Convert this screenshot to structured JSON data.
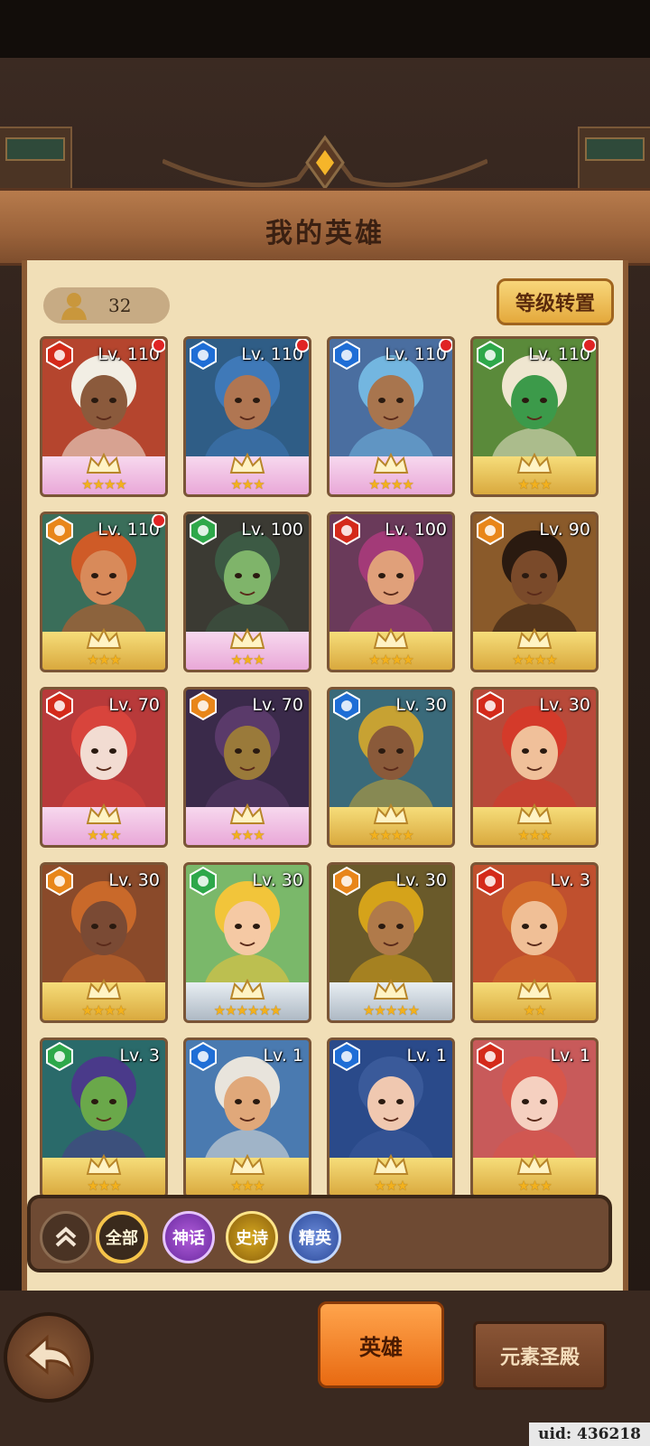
{
  "header": {
    "title": "我的英雄"
  },
  "hero_count": "32",
  "level_reset_label": "等级转置",
  "heroes": [
    {
      "level": "Lv. 110",
      "element": "fire",
      "stars": "★★★★",
      "frame": "pink",
      "badge": true,
      "skin": "#8b5a3c",
      "hair": "#f2eee4",
      "bg": "#b5452e"
    },
    {
      "level": "Lv. 110",
      "element": "water",
      "stars": "★★★",
      "frame": "pink",
      "badge": true,
      "skin": "#b07652",
      "hair": "#3f79b8",
      "bg": "#2f5d86"
    },
    {
      "level": "Lv. 110",
      "element": "water",
      "stars": "★★★★",
      "frame": "pink",
      "badge": true,
      "skin": "#a8754e",
      "hair": "#73b6e0",
      "bg": "#4a6ea0"
    },
    {
      "level": "Lv. 110",
      "element": "nature",
      "stars": "★★★",
      "frame": "gold",
      "badge": true,
      "skin": "#3c9a4a",
      "hair": "#efe6d0",
      "bg": "#5a8a3a"
    },
    {
      "level": "Lv. 110",
      "element": "earth",
      "stars": "★★★",
      "frame": "gold",
      "badge": true,
      "skin": "#d88a5a",
      "hair": "#cf5b27",
      "bg": "#3a6e5a"
    },
    {
      "level": "Lv. 100",
      "element": "nature",
      "stars": "★★★",
      "frame": "pink",
      "badge": false,
      "skin": "#7fb46a",
      "hair": "#3c5a44",
      "bg": "#3b3a33"
    },
    {
      "level": "Lv. 100",
      "element": "fire",
      "stars": "★★★★",
      "frame": "gold",
      "badge": false,
      "skin": "#e0a07a",
      "hair": "#a33a78",
      "bg": "#6a3a5a"
    },
    {
      "level": "Lv. 90",
      "element": "earth",
      "stars": "★★★★",
      "frame": "gold",
      "badge": false,
      "skin": "#7a4a2a",
      "hair": "#2a1a10",
      "bg": "#8a5a2a"
    },
    {
      "level": "Lv. 70",
      "element": "fire",
      "stars": "★★★",
      "frame": "pink",
      "badge": false,
      "skin": "#f2dcd2",
      "hair": "#d8443c",
      "bg": "#b83a3a"
    },
    {
      "level": "Lv. 70",
      "element": "earth",
      "stars": "★★★",
      "frame": "pink",
      "badge": false,
      "skin": "#9a7a3a",
      "hair": "#5a3a6a",
      "bg": "#3a2a4a"
    },
    {
      "level": "Lv. 30",
      "element": "water",
      "stars": "★★★★",
      "frame": "gold",
      "badge": false,
      "skin": "#8a5a3a",
      "hair": "#c7a233",
      "bg": "#3a6a7a"
    },
    {
      "level": "Lv. 30",
      "element": "fire",
      "stars": "★★★",
      "frame": "gold",
      "badge": false,
      "skin": "#f0c09a",
      "hair": "#d43a2a",
      "bg": "#b84a3a"
    },
    {
      "level": "Lv. 30",
      "element": "earth",
      "stars": "★★★★",
      "frame": "gold",
      "badge": false,
      "skin": "#7a4a34",
      "hair": "#c9692a",
      "bg": "#8a4a2a"
    },
    {
      "level": "Lv. 30",
      "element": "nature",
      "stars": "★★★★★★",
      "frame": "silver",
      "badge": false,
      "skin": "#f5c9a4",
      "hair": "#f2c53a",
      "bg": "#7ab86a"
    },
    {
      "level": "Lv. 30",
      "element": "earth",
      "stars": "★★★★★",
      "frame": "silver",
      "badge": false,
      "skin": "#b07a4a",
      "hair": "#d5a31a",
      "bg": "#6a5a2a"
    },
    {
      "level": "Lv. 3",
      "element": "fire",
      "stars": "★★",
      "frame": "gold",
      "badge": false,
      "skin": "#f0bf96",
      "hair": "#d26a2a",
      "bg": "#c0502e"
    },
    {
      "level": "Lv. 3",
      "element": "nature",
      "stars": "★★★",
      "frame": "gold",
      "badge": false,
      "skin": "#6aa84a",
      "hair": "#4a3a8a",
      "bg": "#2a6a6a"
    },
    {
      "level": "Lv. 1",
      "element": "water",
      "stars": "★★★",
      "frame": "gold",
      "badge": false,
      "skin": "#e0a87a",
      "hair": "#e8e4dc",
      "bg": "#4a7ab0"
    },
    {
      "level": "Lv. 1",
      "element": "water",
      "stars": "★★★",
      "frame": "gold",
      "badge": false,
      "skin": "#f0c8b0",
      "hair": "#3a5a9a",
      "bg": "#2a4a8a"
    },
    {
      "level": "Lv. 1",
      "element": "fire",
      "stars": "★★★",
      "frame": "gold",
      "badge": false,
      "skin": "#f5d0c0",
      "hair": "#d8564a",
      "bg": "#c85a5a"
    }
  ],
  "element_colors": {
    "fire": "#d42a1a",
    "water": "#1f6ed6",
    "nature": "#2ea84a",
    "earth": "#e8861a"
  },
  "filters": {
    "all": "全部",
    "myth": "神话",
    "epic": "史诗",
    "elite": "精英"
  },
  "tabs": {
    "heroes": "英雄",
    "temple": "元素圣殿"
  },
  "uid": "uid: 436218"
}
